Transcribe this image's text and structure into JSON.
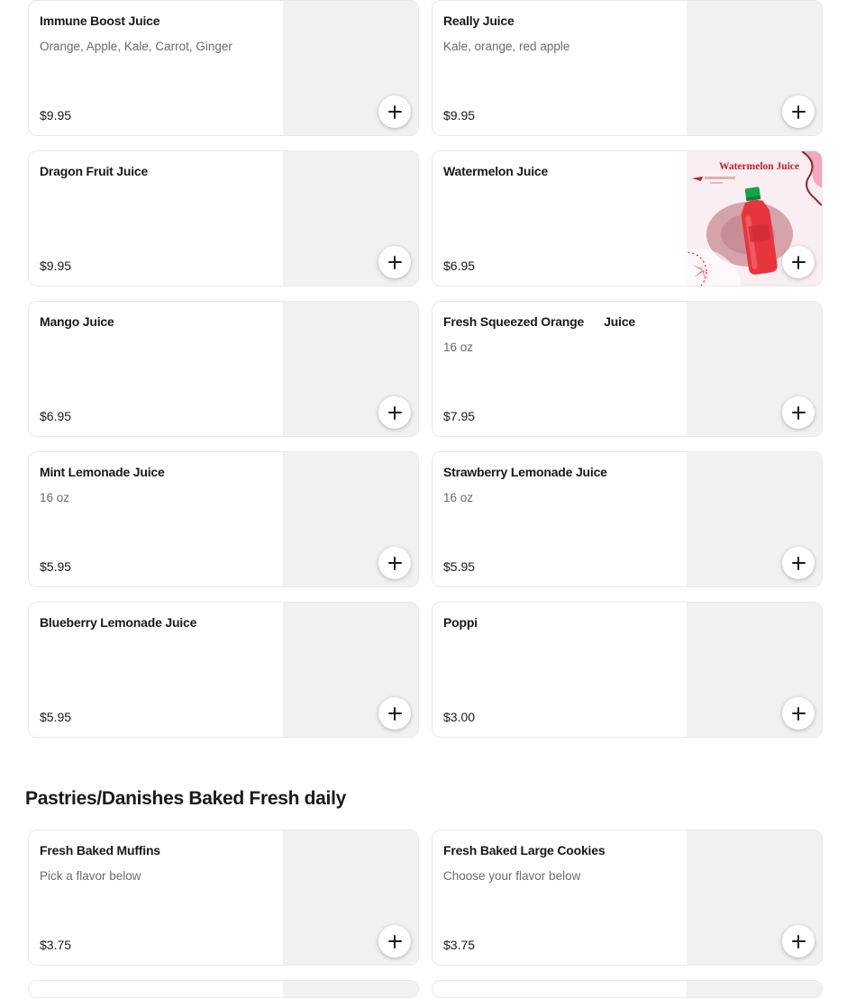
{
  "juices": [
    {
      "name": "Immune Boost Juice",
      "description": "Orange, Apple, Kale, Carrot, Ginger",
      "price": "$9.95"
    },
    {
      "name": "Really Juice",
      "description": "Kale, orange, red apple",
      "price": "$9.95"
    },
    {
      "name": "Dragon Fruit Juice",
      "description": "",
      "price": "$9.95"
    },
    {
      "name": "Watermelon Juice",
      "description": "",
      "price": "$6.95",
      "image_title": "Watermelon Juice",
      "has_image": true
    },
    {
      "name": "Mango Juice",
      "description": "",
      "price": "$6.95"
    },
    {
      "name": "Fresh Squeezed Orange      Juice",
      "description": "16 oz",
      "price": "$7.95"
    },
    {
      "name": "Mint Lemonade Juice",
      "description": "16 oz",
      "price": "$5.95"
    },
    {
      "name": "Strawberry Lemonade Juice",
      "description": "16 oz",
      "price": "$5.95"
    },
    {
      "name": "Blueberry Lemonade Juice",
      "description": "",
      "price": "$5.95"
    },
    {
      "name": "Poppi",
      "description": "",
      "price": "$3.00"
    }
  ],
  "pastries_section": {
    "title": "Pastries/Danishes Baked Fresh daily",
    "items": [
      {
        "name": "Fresh Baked Muffins",
        "description": "Pick a flavor below",
        "price": "$3.75"
      },
      {
        "name": "Fresh Baked Large Cookies",
        "description": "Choose your flavor below",
        "price": "$3.75"
      }
    ]
  },
  "icons": {
    "add": "plus-icon"
  },
  "colors": {
    "text": "#191919",
    "muted": "#6b6b6b",
    "placeholder": "#f1f1f1",
    "border": "#e8e8e8",
    "accent": "#e2222b"
  }
}
